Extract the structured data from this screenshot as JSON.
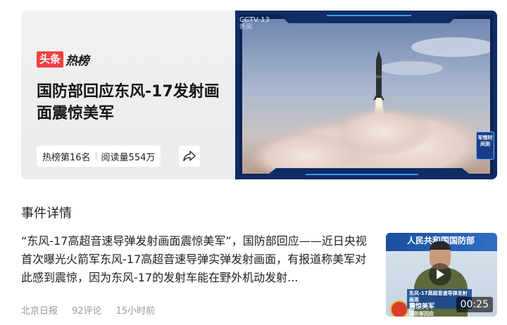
{
  "hero": {
    "brand_badge": "头条",
    "brand_word": "热榜",
    "title": "国防部回应东风-17发射画面震惊美军",
    "rank_label": "热榜第16名",
    "reads_label": "阅读量554万",
    "share_icon": "share-arrow-icon",
    "image": {
      "channel_logo": "CCTV 13",
      "channel_sub": "新闻",
      "corner_badge": "军情时间到"
    }
  },
  "section": {
    "title": "事件详情"
  },
  "article": {
    "text": "“东风-17高超音速导弹发射画面震惊美军”，国防部回应——近日央视首次曝光火箭军东风-17高超音速导弹实弹发射画面，有报道称美军对此感到震惊，因为东风-17的发射车能在野外机动发射...",
    "source": "北京日报",
    "comments": "92评论",
    "time": "15小时前"
  },
  "video": {
    "banner_text": "人民共和国国防部",
    "caption_line1": "东风-17高超音速导弹发射画面",
    "caption_line2": "震惊美军",
    "caption_line3": "国防部回应",
    "duration": "00:25",
    "play_icon": "play-icon"
  },
  "colors": {
    "brand_red": "#f04142",
    "text_primary": "#222222",
    "text_meta": "#999999",
    "hero_bg": "#efeff1"
  }
}
